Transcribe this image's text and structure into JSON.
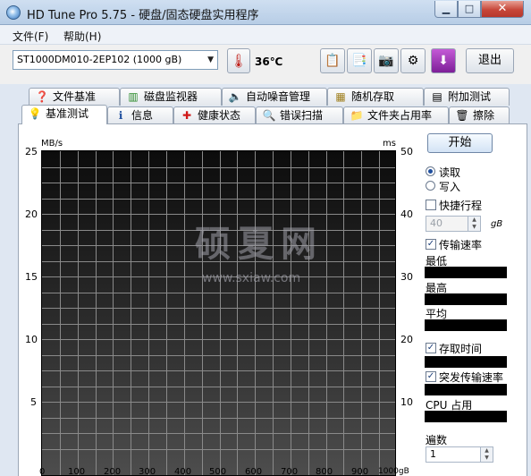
{
  "window": {
    "title": "HD Tune Pro 5.75 - 硬盘/固态硬盘实用程序",
    "minimize": "▁",
    "maximize": "□",
    "close": "✕"
  },
  "menu": [
    {
      "label": "文件(F)"
    },
    {
      "label": "帮助(H)"
    }
  ],
  "toolbar": {
    "drive": "ST1000DM010-2EP102 (1000 gB)",
    "temperature": "36℃",
    "exit_label": "退出",
    "icons": [
      "copy-icon",
      "copy-all-icon",
      "camera-icon",
      "options-icon",
      "save-icon"
    ]
  },
  "tabs_back": [
    {
      "label": "文件基准",
      "icon": "file-benchmark-icon"
    },
    {
      "label": "磁盘监视器",
      "icon": "disk-monitor-icon"
    },
    {
      "label": "自动噪音管理",
      "icon": "aam-icon"
    },
    {
      "label": "随机存取",
      "icon": "random-access-icon"
    },
    {
      "label": "附加测试",
      "icon": "extra-tests-icon"
    }
  ],
  "tabs_front": [
    {
      "label": "基准测试",
      "icon": "benchmark-icon",
      "active": true
    },
    {
      "label": "信息",
      "icon": "info-icon"
    },
    {
      "label": "健康状态",
      "icon": "health-icon"
    },
    {
      "label": "错误扫描",
      "icon": "error-scan-icon"
    },
    {
      "label": "文件夹占用率",
      "icon": "folder-usage-icon"
    },
    {
      "label": "擦除",
      "icon": "erase-icon"
    }
  ],
  "chart": {
    "unit_left": "MB/s",
    "unit_right": "ms",
    "y_left_ticks": [
      "25",
      "20",
      "15",
      "10",
      "5"
    ],
    "y_right_ticks": [
      "50",
      "40",
      "30",
      "20",
      "10"
    ],
    "x_ticks": [
      "0",
      "100",
      "200",
      "300",
      "400",
      "500",
      "600",
      "700",
      "800",
      "900",
      "1000gB"
    ]
  },
  "watermark": {
    "text": "硕夏网",
    "url": "www.sxiaw.com"
  },
  "controls": {
    "start_label": "开始",
    "read_label": "读取",
    "write_label": "写入",
    "short_stroke_label": "快捷行程",
    "short_stroke_value": "40",
    "short_stroke_unit": "gB",
    "transfer_rate_label": "传输速率",
    "min_label": "最低",
    "max_label": "最高",
    "avg_label": "平均",
    "access_time_label": "存取时间",
    "burst_rate_label": "突发传输速率",
    "cpu_label": "CPU 占用",
    "passes_label": "遍数",
    "passes_value": "1"
  },
  "colors": {
    "chart_top": "#0c0c0c",
    "chart_bottom": "#4d4d4d",
    "grid": "#8a8a8a"
  }
}
